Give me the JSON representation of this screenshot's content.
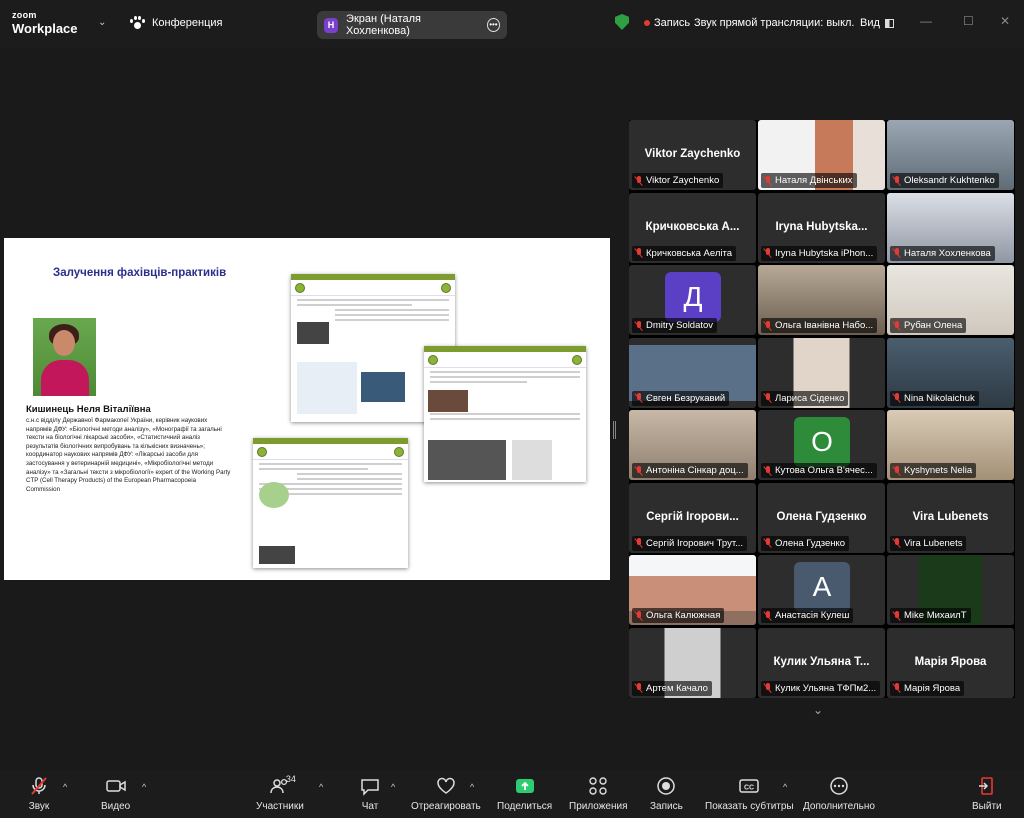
{
  "app": {
    "logo_top": "zoom",
    "logo_bottom": "Workplace",
    "conference_label": "Конференция",
    "screen_badge": "H",
    "screen_label": "Экран (Наталя Хохленкова)",
    "recording_label": "Запись",
    "livestream_label": "Звук прямой трансляции: выкл.",
    "view_label": "Вид",
    "accent_green": "#2ecc71",
    "record_red": "#e53935"
  },
  "slide": {
    "title": "Залучення фахівців-практиків",
    "person_name": "Кишинець Неля Віталіївна",
    "bio": "с.н.с відділу Державної Фармакопеї України, керівник наукових напрямів ДФУ: «Біологічні методи аналізу», «Монографії та загальні тексти на біологічні лікарські засоби», «Статистичний аналіз результатів біологічних випробувань та кількісних визначень»; координатор наукових напрямів ДФУ: «Лікарські засоби для застосування у ветеринарній медицині», «Мікробіологічні методи аналізу» та «Загальні тексти з мікробіології» expert of the Working Party CTP (Cell Therapy Products) of the European Pharmacopoeia Commission"
  },
  "participants": [
    {
      "big": "Viktor Zaychenko",
      "label": "Viktor Zaychenko"
    },
    {
      "big": "",
      "label": "Наталя Двінських"
    },
    {
      "big": "",
      "label": "Oleksandr Kukhtenko"
    },
    {
      "big": "Кричковська А...",
      "label": "Кричковська Аеліта"
    },
    {
      "big": "Iryna  Hubytska...",
      "label": "Iryna Hubytska iPhon..."
    },
    {
      "big": "",
      "label": "Наталя Хохленкова"
    },
    {
      "big": "",
      "avatar": "Д",
      "label": "Dmitry Soldatov"
    },
    {
      "big": "",
      "label": "Ольга Іванівна Набо..."
    },
    {
      "big": "",
      "label": "Рубан Олена"
    },
    {
      "big": "",
      "label": "Євген Безрукавий"
    },
    {
      "big": "",
      "label": "Лариса Сіденко"
    },
    {
      "big": "",
      "label": "Nina Nikolaichuk"
    },
    {
      "big": "",
      "label": "Антоніна Сінкар доц..."
    },
    {
      "big": "",
      "avatar": "О",
      "label": "Кутова Ольга В'ячес..."
    },
    {
      "big": "",
      "label": "Kyshynets Nelia"
    },
    {
      "big": "Сергій Ігорови...",
      "label": "Сергій Ігорович Трут..."
    },
    {
      "big": "Олена Гудзенко",
      "label": "Олена Гудзенко"
    },
    {
      "big": "Vira Lubenets",
      "label": "Vira Lubenets"
    },
    {
      "big": "",
      "label": "Ольга Калюжная"
    },
    {
      "big": "",
      "avatar": "А",
      "label": "Анастасія Кулеш"
    },
    {
      "big": "",
      "label": "Mike МихаилТ"
    },
    {
      "big": "",
      "label": "Артем Качало"
    },
    {
      "big": "Кулик Ульяна Т...",
      "label": "Кулик Ульяна ТФПм2..."
    },
    {
      "big": "Марія Ярова",
      "label": "Марія Ярова"
    }
  ],
  "toolbar": {
    "audio": "Звук",
    "video": "Видео",
    "participants": "Участники",
    "participants_count": "34",
    "chat": "Чат",
    "react": "Отреагировать",
    "share": "Поделиться",
    "apps": "Приложения",
    "record": "Запись",
    "captions": "Показать субтитры",
    "more": "Дополнительно",
    "leave": "Выйти"
  }
}
